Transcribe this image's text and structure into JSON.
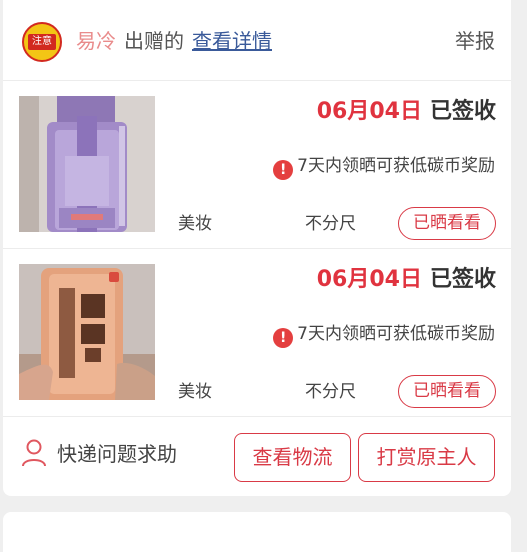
{
  "header": {
    "badge_text": "注意",
    "donor_name": "易冷",
    "gift_text": "出赠的",
    "detail_link": "查看详情",
    "report": "举报"
  },
  "items": [
    {
      "date": "06月04日",
      "status": "已签收",
      "reward_text": "7天内领晒可获低碳币奖励",
      "category": "美妆",
      "size": "不分尺",
      "button": "已晒看看",
      "image": "purple-perfume-bottle"
    },
    {
      "date": "06月04日",
      "status": "已签收",
      "reward_text": "7天内领晒可获低碳币奖励",
      "category": "美妆",
      "size": "不分尺",
      "button": "已晒看看",
      "image": "orange-shampoo-bottle"
    }
  ],
  "footer": {
    "help_label": "快递问题求助",
    "logistics_button": "查看物流",
    "reward_button": "打赏原主人"
  },
  "colors": {
    "accent": "#d93a46",
    "date_red": "#e0333f",
    "link_blue": "#3a5a9a",
    "donor_pink": "#e98b8b"
  },
  "icons": [
    "warning-icon",
    "person-icon",
    "badge-icon"
  ]
}
